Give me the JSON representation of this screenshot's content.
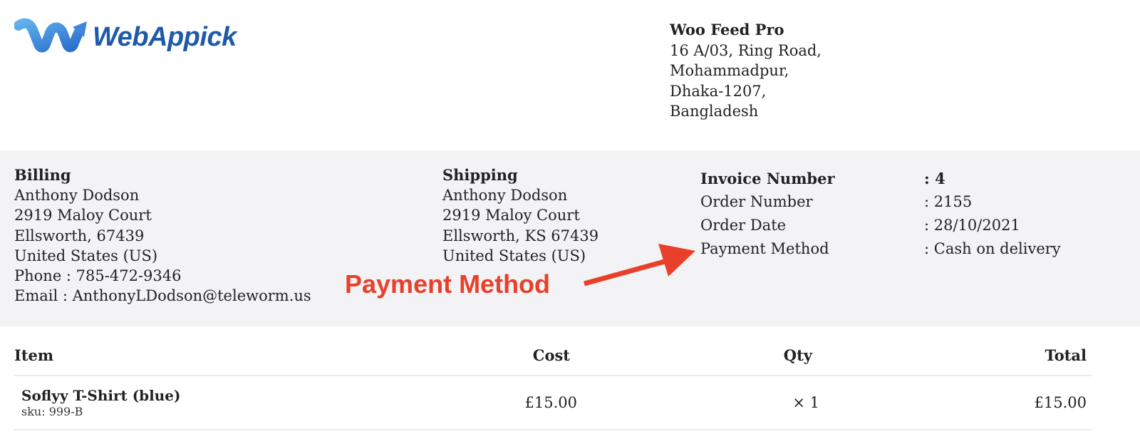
{
  "header": {
    "logo_text": "WebAppick",
    "brand_color": "#1f5aa8",
    "company": {
      "name": "Woo Feed Pro",
      "address_lines": [
        "16 A/03, Ring Road,",
        "Mohammadpur,",
        "Dhaka-1207,",
        "Bangladesh"
      ]
    }
  },
  "billing": {
    "title": "Billing",
    "lines": [
      "Anthony Dodson",
      "2919 Maloy Court",
      "Ellsworth, 67439",
      "United States (US)",
      "Phone : 785-472-9346",
      "Email : AnthonyLDodson@teleworm.us"
    ]
  },
  "shipping": {
    "title": "Shipping",
    "lines": [
      "Anthony Dodson",
      "2919 Maloy Court",
      "Ellsworth, KS 67439",
      "United States (US)"
    ]
  },
  "invoice_meta": [
    {
      "label": "Invoice Number",
      "value": ": 4",
      "bold": true
    },
    {
      "label": "Order Number",
      "value": ": 2155",
      "bold": false
    },
    {
      "label": "Order Date",
      "value": ": 28/10/2021",
      "bold": false
    },
    {
      "label": "Payment Method",
      "value": ": Cash on delivery",
      "bold": false
    }
  ],
  "annotation": {
    "text": "Payment Method",
    "color": "#e8402a",
    "icon": "arrow-right-up-icon"
  },
  "items_table": {
    "headers": {
      "item": "Item",
      "cost": "Cost",
      "qty": "Qty",
      "total": "Total"
    },
    "rows": [
      {
        "name": "Soflyy T-Shirt (blue)",
        "sku": "sku: 999-B",
        "cost": "£15.00",
        "qty": "× 1",
        "total": "£15.00"
      }
    ]
  }
}
